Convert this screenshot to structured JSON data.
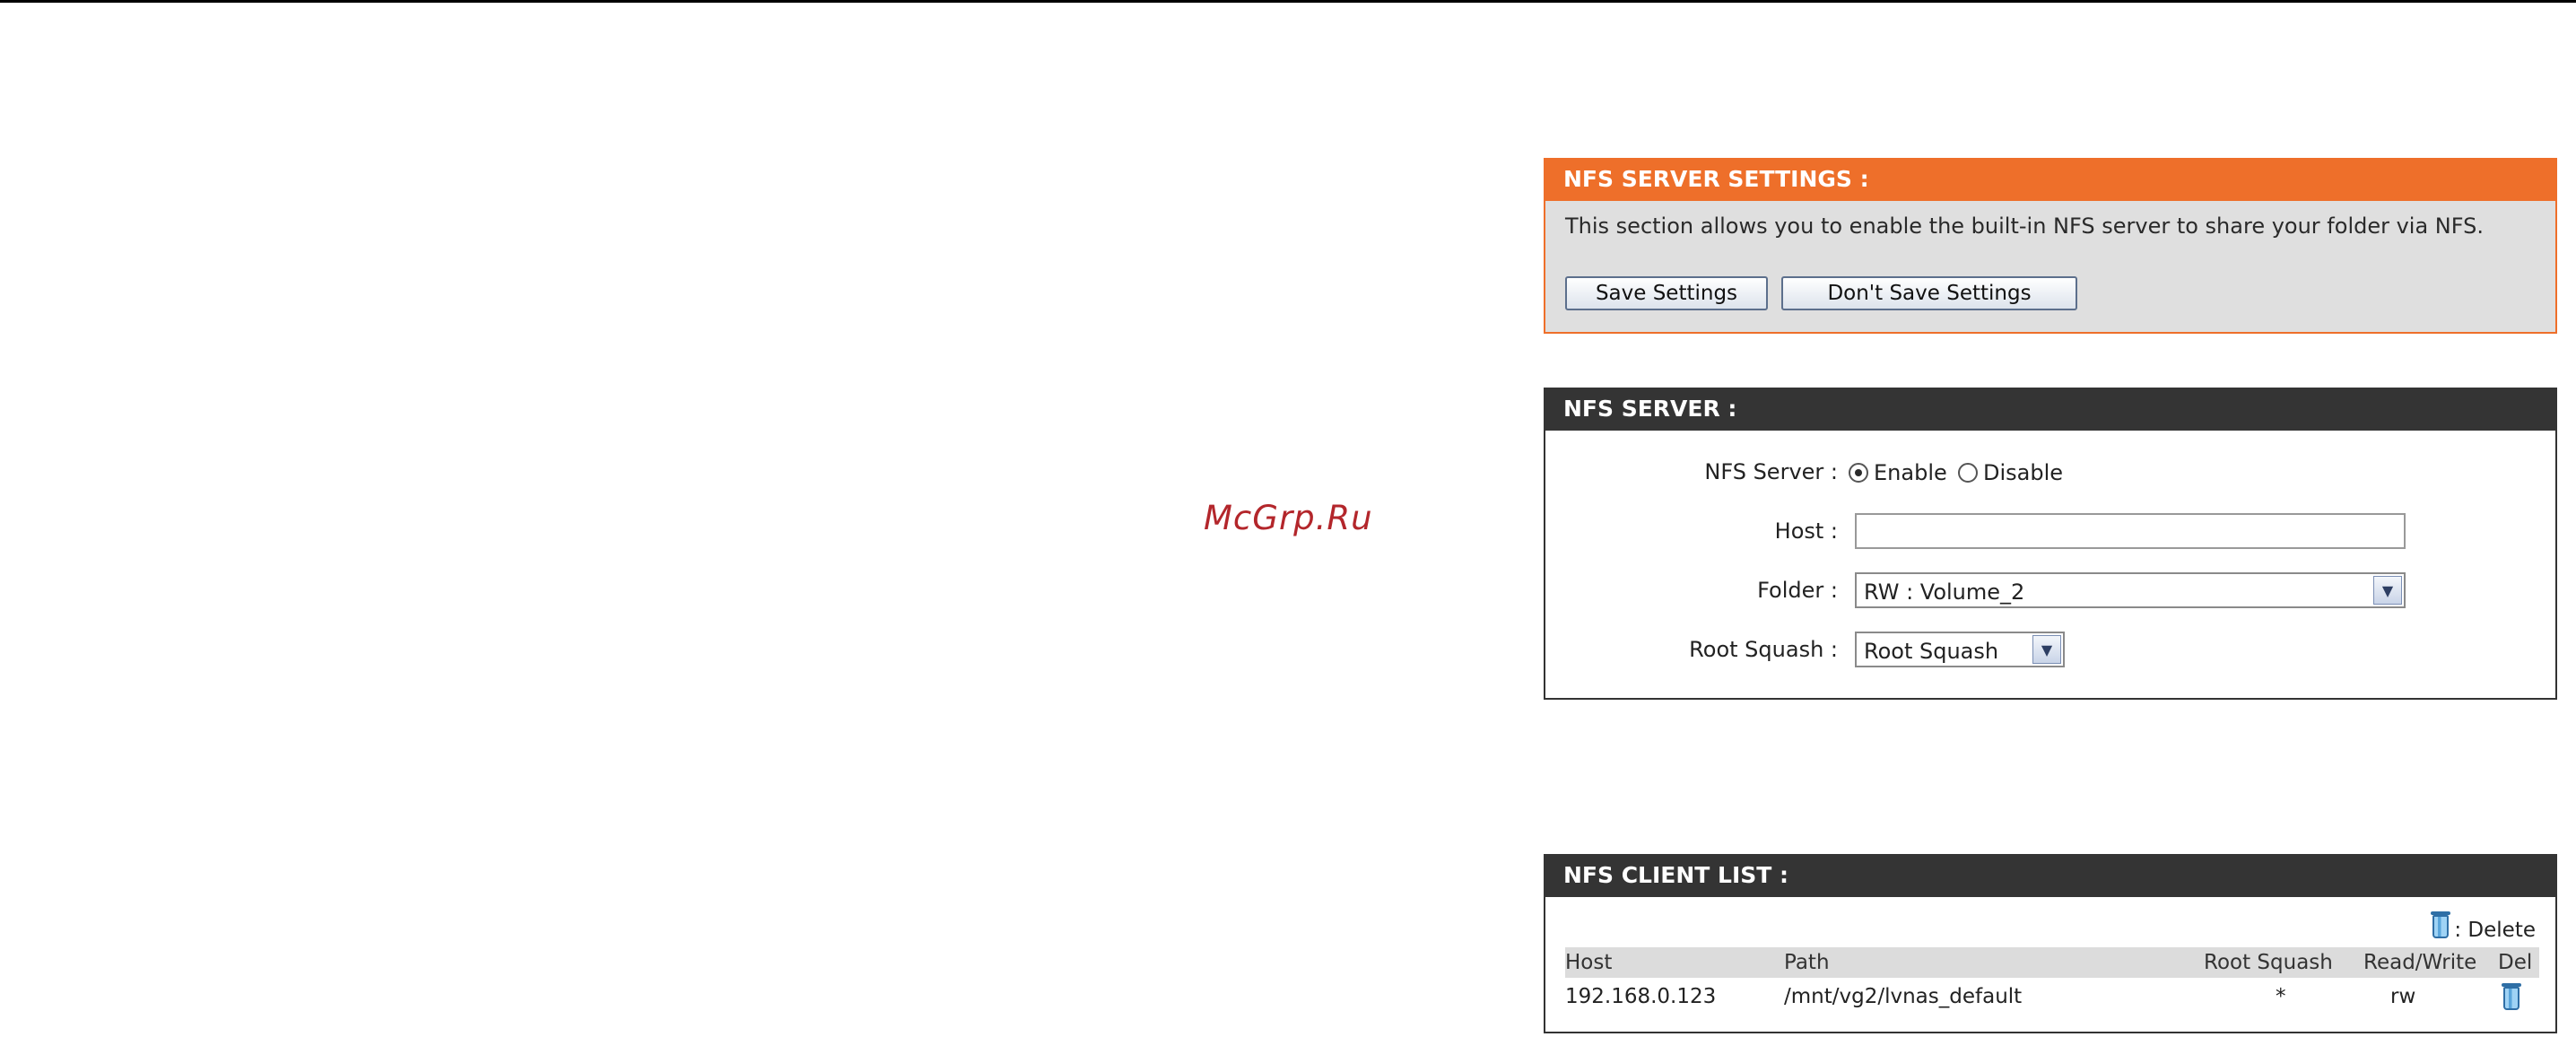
{
  "watermark": "McGrp.Ru",
  "settings_panel": {
    "title": "NFS SERVER SETTINGS :",
    "description": "This section allows you to enable the built-in NFS server to share your folder via NFS.",
    "save_label": "Save Settings",
    "dont_save_label": "Don't Save Settings"
  },
  "server_panel": {
    "title": "NFS SERVER :",
    "nfs_server_label": "NFS Server :",
    "enable_label": "Enable",
    "disable_label": "Disable",
    "nfs_server_selected": "Enable",
    "host_label": "Host :",
    "host_value": "",
    "folder_label": "Folder :",
    "folder_value": "RW : Volume_2",
    "root_squash_label": "Root Squash :",
    "root_squash_value": "Root Squash"
  },
  "client_panel": {
    "title": "NFS CLIENT LIST :",
    "legend": ": Delete",
    "columns": {
      "host": "Host",
      "path": "Path",
      "root_squash": "Root Squash",
      "read_write": "Read/Write",
      "del": "Del"
    },
    "rows": [
      {
        "host": "192.168.0.123",
        "path": "/mnt/vg2/lvnas_default",
        "root_squash": "*",
        "read_write": "rw"
      }
    ]
  },
  "colors": {
    "settings_header": "#ee6f2a",
    "panel_header": "#343434",
    "watermark": "#b3262b"
  },
  "icons": [
    "trash-icon",
    "chevron-down-icon"
  ]
}
